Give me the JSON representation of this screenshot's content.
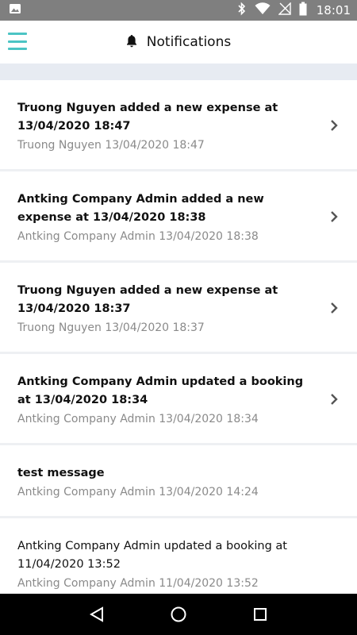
{
  "status_bar": {
    "time": "18:01"
  },
  "header": {
    "title": "Notifications"
  },
  "notifications": [
    {
      "title": "Truong Nguyen added a new expense at 13/04/2020 18:47",
      "meta": "Truong Nguyen 13/04/2020 18:47",
      "read": false
    },
    {
      "title": "Antking Company Admin added a new expense at 13/04/2020 18:38",
      "meta": "Antking Company Admin 13/04/2020 18:38",
      "read": false
    },
    {
      "title": "Truong Nguyen added a new expense at 13/04/2020 18:37",
      "meta": "Truong Nguyen 13/04/2020 18:37",
      "read": false
    },
    {
      "title": "Antking Company Admin updated a booking at 13/04/2020 18:34",
      "meta": "Antking Company Admin 13/04/2020 18:34",
      "read": false
    },
    {
      "title": "test message",
      "meta": "Antking Company Admin 13/04/2020 14:24",
      "read": false
    },
    {
      "title": "Antking Company Admin updated a booking at 11/04/2020 13:52",
      "meta": "Antking Company Admin 11/04/2020 13:52",
      "read": true
    }
  ],
  "colors": {
    "accent": "#4cc4c4",
    "status_bar": "#7f7f7f",
    "band": "#e7ebf2",
    "meta_text": "#8a8a8a"
  }
}
